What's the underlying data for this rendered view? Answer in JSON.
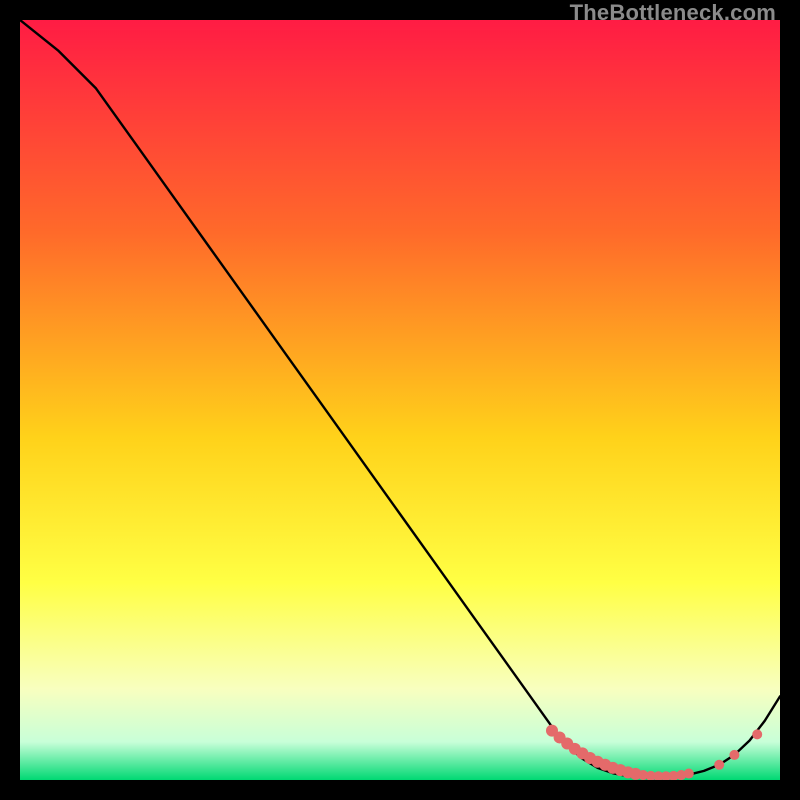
{
  "watermark": "TheBottleneck.com",
  "colors": {
    "black": "#000000",
    "grad_top": "#ff1c44",
    "grad_mid1": "#ff6a2a",
    "grad_mid2": "#ffd21a",
    "grad_mid3": "#ffff44",
    "grad_mid4": "#f8ffbf",
    "grad_bottom_band": "#c8ffd8",
    "grad_bottom": "#00d973",
    "curve": "#000000",
    "dot_fill": "#e46a6a",
    "dot_stroke": "#c84f4f"
  },
  "chart_data": {
    "type": "line",
    "title": "",
    "xlabel": "",
    "ylabel": "",
    "xlim": [
      0,
      100
    ],
    "ylim": [
      0,
      100
    ],
    "series": [
      {
        "name": "curve",
        "x": [
          0,
          5,
          10,
          15,
          20,
          25,
          30,
          35,
          40,
          45,
          50,
          55,
          60,
          65,
          70,
          72,
          74,
          76,
          78,
          80,
          82,
          84,
          86,
          88,
          90,
          92,
          94,
          96,
          98,
          100
        ],
        "y": [
          100,
          96,
          91,
          84,
          77,
          70,
          63,
          56,
          49,
          42,
          35,
          28,
          21,
          14,
          7,
          4.5,
          2.8,
          1.6,
          0.9,
          0.5,
          0.3,
          0.3,
          0.4,
          0.7,
          1.2,
          2.0,
          3.3,
          5.2,
          7.8,
          11
        ]
      }
    ],
    "dots": {
      "name": "markers",
      "x": [
        70,
        71,
        72,
        73,
        74,
        75,
        76,
        77,
        78,
        79,
        80,
        81,
        82,
        83,
        84,
        85,
        86,
        87,
        88,
        92,
        94,
        97
      ],
      "y": [
        6.5,
        5.6,
        4.8,
        4.1,
        3.5,
        2.9,
        2.4,
        2.0,
        1.6,
        1.3,
        1.0,
        0.8,
        0.65,
        0.55,
        0.5,
        0.5,
        0.55,
        0.65,
        0.85,
        2.0,
        3.3,
        6.0
      ]
    }
  }
}
